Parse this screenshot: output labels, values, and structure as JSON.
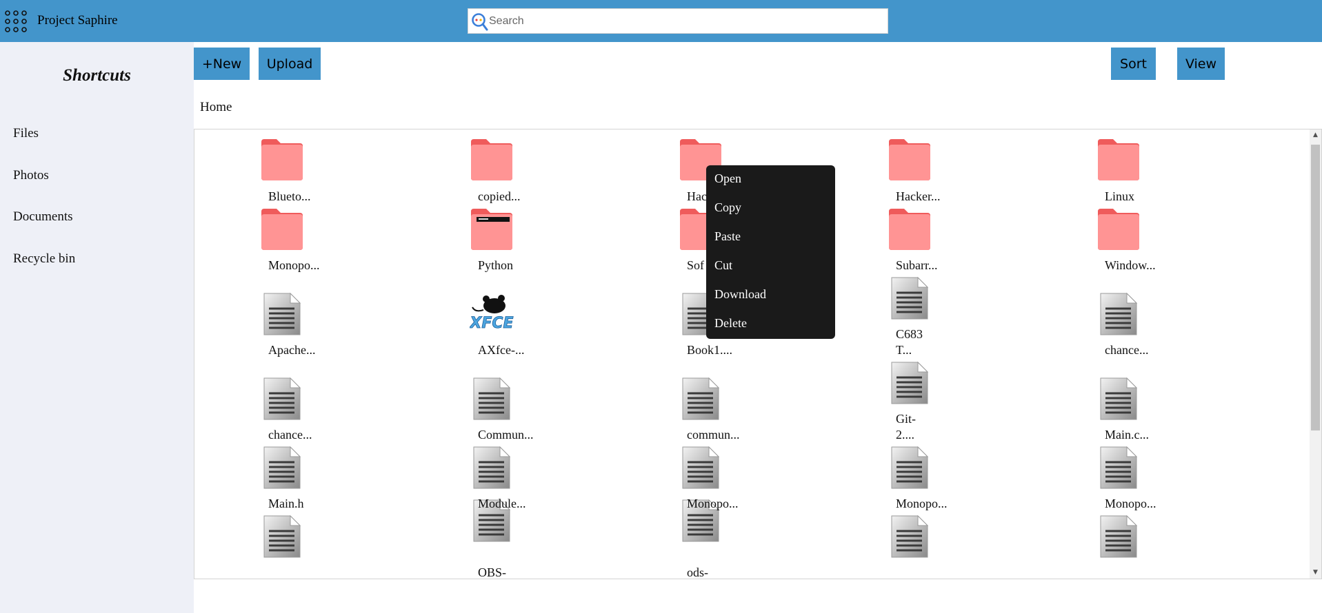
{
  "header": {
    "app_title": "Project Saphire",
    "search_placeholder": "Search",
    "search_value": ""
  },
  "sidebar": {
    "title": "Shortcuts",
    "items": [
      {
        "label": "Files"
      },
      {
        "label": "Photos"
      },
      {
        "label": "Documents"
      },
      {
        "label": "Recycle bin"
      }
    ]
  },
  "toolbar": {
    "new_label": "+New",
    "upload_label": "Upload",
    "sort_label": "Sort",
    "view_label": "View"
  },
  "breadcrumb": "Home",
  "files": [
    {
      "name": "Blueto...",
      "type": "folder"
    },
    {
      "name": "copied...",
      "type": "folder"
    },
    {
      "name": "Hac",
      "type": "folder"
    },
    {
      "name": "Hacker...",
      "type": "folder"
    },
    {
      "name": "Linux",
      "type": "folder"
    },
    {
      "name": "Monopo...",
      "type": "folder"
    },
    {
      "name": "Python",
      "type": "folder-python"
    },
    {
      "name": "Sof",
      "type": "folder"
    },
    {
      "name": "Subarr...",
      "type": "folder"
    },
    {
      "name": "Window...",
      "type": "folder"
    },
    {
      "name": "Apache...",
      "type": "file"
    },
    {
      "name": "AXfce-...",
      "type": "xfce"
    },
    {
      "name": "Book1....",
      "type": "file"
    },
    {
      "name": "C683\nT...",
      "type": "file"
    },
    {
      "name": "chance...",
      "type": "file"
    },
    {
      "name": "chance...",
      "type": "file"
    },
    {
      "name": "Commun...",
      "type": "file"
    },
    {
      "name": "commun...",
      "type": "file"
    },
    {
      "name": "Git-\n2....",
      "type": "file"
    },
    {
      "name": "Main.c...",
      "type": "file"
    },
    {
      "name": "Main.h",
      "type": "file"
    },
    {
      "name": "Module...",
      "type": "file"
    },
    {
      "name": "Monopo...",
      "type": "file"
    },
    {
      "name": "Monopo...",
      "type": "file"
    },
    {
      "name": "Monopo...",
      "type": "file"
    },
    {
      "name": "",
      "type": "file"
    },
    {
      "name": "OBS-",
      "type": "file"
    },
    {
      "name": "ods-",
      "type": "file"
    },
    {
      "name": "",
      "type": "file"
    },
    {
      "name": "",
      "type": "file"
    }
  ],
  "context_menu": {
    "items": [
      {
        "label": "Open"
      },
      {
        "label": "Copy"
      },
      {
        "label": "Paste"
      },
      {
        "label": "Cut"
      },
      {
        "label": "Download"
      },
      {
        "label": "Delete"
      }
    ]
  },
  "icons": {
    "apps": "apps-grid-icon",
    "search": "search-logo-icon",
    "folder": "folder-icon",
    "file": "document-icon",
    "xfce": "xfce-logo-icon",
    "scroll_up": "scroll-up-arrow-icon",
    "scroll_down": "scroll-down-arrow-icon"
  },
  "colors": {
    "header": "#4395cb",
    "sidebar": "#eef0f7",
    "folder": "#ff8f8f",
    "context_menu": "#1a1a1a"
  }
}
